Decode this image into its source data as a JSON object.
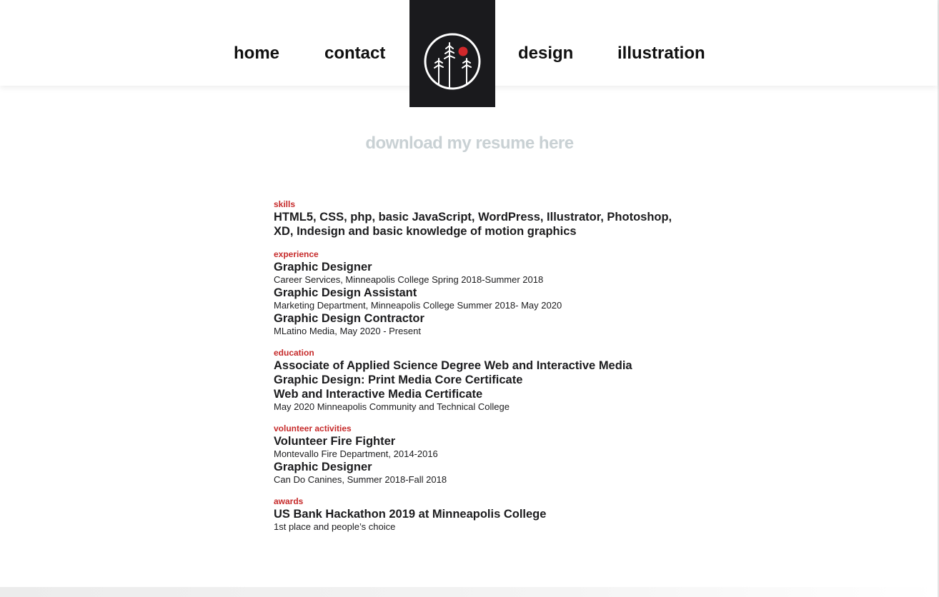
{
  "nav": {
    "home": "home",
    "contact": "contact",
    "design": "design",
    "illustration": "illustration"
  },
  "logo": {
    "icon": "pine-trees-moon-logo-icon",
    "background": "#1a1a1d",
    "accent": "#d0282b"
  },
  "download": {
    "label": "download my resume here"
  },
  "colors": {
    "section_label": "#c62a2a",
    "text": "#1c1c1e",
    "download": "#c9d1d4"
  },
  "resume": {
    "skills": {
      "label": "skills",
      "text": "HTML5, CSS, php, basic JavaScript, WordPress, Illustrator, Photoshop, XD, Indesign and basic knowledge of motion graphics"
    },
    "experience": {
      "label": "experience",
      "items": [
        {
          "title": "Graphic Designer",
          "sub": "Career Services, Minneapolis College Spring 2018-Summer 2018"
        },
        {
          "title": "Graphic Design Assistant",
          "sub": "Marketing Department, Minneapolis College Summer 2018- May 2020"
        },
        {
          "title": "Graphic Design Contractor",
          "sub": "MLatino Media, May 2020 - Present"
        }
      ]
    },
    "education": {
      "label": "education",
      "lines": [
        "Associate of Applied Science Degree Web and Interactive Media",
        "Graphic Design: Print Media Core Certificate",
        "Web and Interactive Media Certificate"
      ],
      "sub": "May 2020 Minneapolis Community and Technical College"
    },
    "volunteer": {
      "label": "volunteer activities",
      "items": [
        {
          "title": "Volunteer Fire Fighter",
          "sub": "Montevallo Fire Department, 2014-2016"
        },
        {
          "title": "Graphic Designer",
          "sub": "Can Do Canines, Summer 2018-Fall 2018"
        }
      ]
    },
    "awards": {
      "label": "awards",
      "items": [
        {
          "title": "US Bank Hackathon 2019 at Minneapolis College",
          "sub": "1st place and people’s choice"
        }
      ]
    }
  }
}
